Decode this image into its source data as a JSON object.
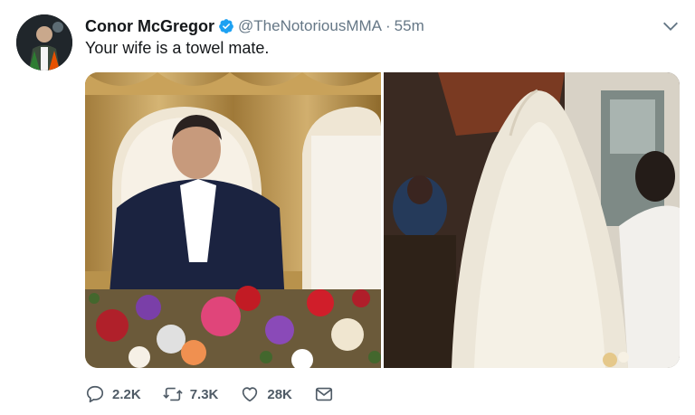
{
  "tweet": {
    "author_name": "Conor McGregor",
    "handle": "@TheNotoriousMMA",
    "separator": "·",
    "time": "55m",
    "text": "Your wife is a towel mate."
  },
  "actions": {
    "replies": "2.2K",
    "retweets": "7.3K",
    "likes": "28K"
  },
  "colors": {
    "verified_badge": "#1da1f2",
    "secondary_text": "#657786",
    "action_text": "#4f5b66"
  },
  "icons": {
    "verified": "verified-badge-icon",
    "caret": "chevron-down-icon",
    "reply": "reply-icon",
    "retweet": "retweet-icon",
    "like": "heart-icon",
    "message": "envelope-icon"
  }
}
